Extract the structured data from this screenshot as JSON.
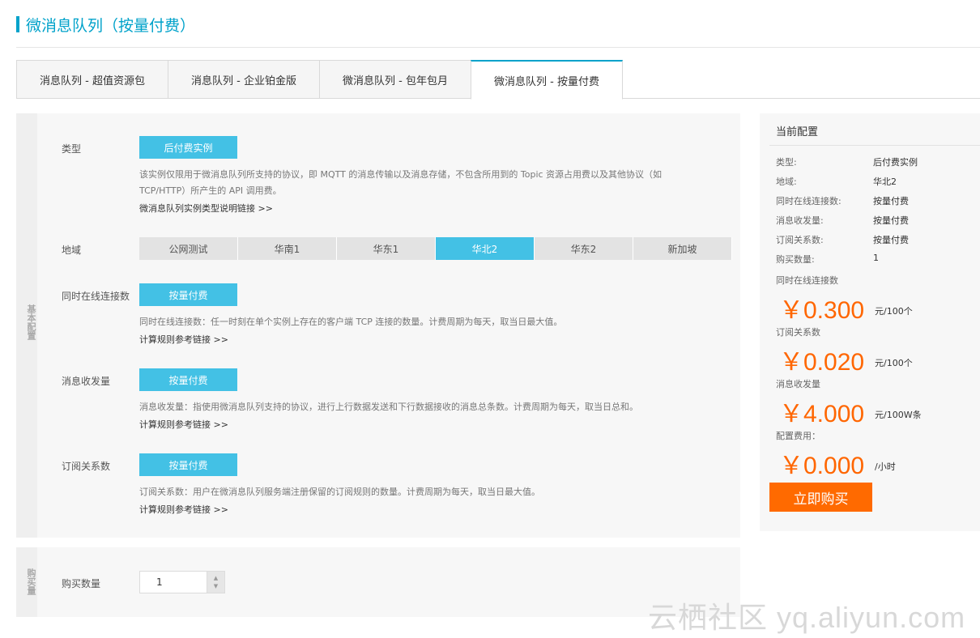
{
  "title": "微消息队列（按量付费）",
  "tabs": [
    {
      "label": "消息队列 - 超值资源包"
    },
    {
      "label": "消息队列 - 企业铂金版"
    },
    {
      "label": "微消息队列 - 包年包月"
    },
    {
      "label": "微消息队列 - 按量付费",
      "active": true
    }
  ],
  "basic_section": {
    "side_label": "基本配置",
    "type": {
      "label": "类型",
      "button": "后付费实例",
      "desc_line1": "该实例仅限用于微消息队列所支持的协议，即 MQTT 的消息传输以及消息存储，不包含所用到的 Topic 资源占用费以及其他协议（如",
      "desc_line2": "TCP/HTTP）所产生的 API 调用费。",
      "link": "微消息队列实例类型说明链接 >>"
    },
    "region": {
      "label": "地域",
      "options": [
        "公网测试",
        "华南1",
        "华东1",
        "华北2",
        "华东2",
        "新加坡"
      ],
      "selected": "华北2"
    },
    "connections": {
      "label": "同时在线连接数",
      "button": "按量付费",
      "desc": "同时在线连接数：任一时刻在单个实例上存在的客户端 TCP 连接的数量。计费周期为每天，取当日最大值。",
      "link": "计算规则参考链接 >>"
    },
    "messages": {
      "label": "消息收发量",
      "button": "按量付费",
      "desc": "消息收发量：指使用微消息队列支持的协议，进行上行数据发送和下行数据接收的消息总条数。计费周期为每天，取当日总和。",
      "link": "计算规则参考链接 >>"
    },
    "subscriptions": {
      "label": "订阅关系数",
      "button": "按量付费",
      "desc": "订阅关系数：用户在微消息队列服务端注册保留的订阅规则的数量。计费周期为每天，取当日最大值。",
      "link": "计算规则参考链接 >>"
    }
  },
  "purchase_section": {
    "side_label": "购买量",
    "quantity_label": "购买数量",
    "quantity_value": "1",
    "up_icon": "▲",
    "down_icon": "▼"
  },
  "current_config": {
    "heading": "当前配置",
    "items": [
      {
        "key": "类型:",
        "value": "后付费实例"
      },
      {
        "key": "地域:",
        "value": "华北2"
      },
      {
        "key": "同时在线连接数:",
        "value": "按量付费"
      },
      {
        "key": "消息收发量:",
        "value": "按量付费"
      },
      {
        "key": "订阅关系数:",
        "value": "按量付费"
      },
      {
        "key": "购买数量:",
        "value": "1"
      }
    ],
    "prices": [
      {
        "label": "同时在线连接数",
        "amount": "￥0.300",
        "unit": "元/100个"
      },
      {
        "label": "订阅关系数",
        "amount": "￥0.020",
        "unit": "元/100个"
      },
      {
        "label": "消息收发量",
        "amount": "￥4.000",
        "unit": "元/100W条"
      },
      {
        "label": "配置费用：",
        "amount": "￥0.000",
        "unit": "/小时"
      }
    ],
    "buy_button": "立即购买"
  },
  "watermark": "云栖社区 yq.aliyun.com",
  "colors": {
    "accent": "#00a2ca",
    "button_blue": "#43c1e5",
    "price_orange": "#ff6600",
    "buy_orange": "#ff6a00"
  }
}
